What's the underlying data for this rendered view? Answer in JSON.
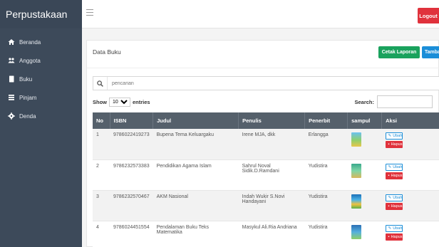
{
  "app": {
    "brand": "Perpustakaan"
  },
  "sidebar": {
    "items": [
      {
        "label": "Beranda",
        "icon": "home-icon"
      },
      {
        "label": "Anggota",
        "icon": "users-icon"
      },
      {
        "label": "Buku",
        "icon": "book-icon"
      },
      {
        "label": "Pinjam",
        "icon": "list-icon"
      },
      {
        "label": "Denda",
        "icon": "gear-icon"
      }
    ]
  },
  "header": {
    "logout_label": "Logout"
  },
  "page": {
    "title": "Data Buku",
    "cetak_label": "Cetak Laporan",
    "tambah_label": "Tambah",
    "search_placeholder": "pencarian",
    "show_label": "Show",
    "entries_value": "10",
    "entries_label": "entries",
    "search_label": "Search:"
  },
  "table": {
    "headers": [
      "No",
      "ISBN",
      "Judul",
      "Penulis",
      "Penerbit",
      "sampul",
      "Aksi"
    ],
    "edit_label": "Ubah",
    "delete_label": "Hapus",
    "rows": [
      {
        "no": "1",
        "isbn": "9786022419273",
        "judul": "Bupena Tema Keluargaku",
        "penulis": "Irene MJA, dkk",
        "penerbit": "Erlangga"
      },
      {
        "no": "2",
        "isbn": "9786232573383",
        "judul": "Pendidikan Agama Islam",
        "penulis": "Sahrul Noval Sidik.D.Ramdani",
        "penerbit": "Yudistira"
      },
      {
        "no": "3",
        "isbn": "9786232570467",
        "judul": "AKM Nasional",
        "penulis": "Indah Wukir S.Novi Handayani",
        "penerbit": "Yudistira"
      },
      {
        "no": "4",
        "isbn": "9786024451554",
        "judul": "Pendalaman Buku Teks Matematika",
        "penulis": "Masykul Ali.Ria Andriana",
        "penerbit": "Yudistira"
      }
    ]
  },
  "colors": {
    "sidebar": "#3d4a5a",
    "logout": "#e0323c",
    "cetak": "#1aa25d",
    "tambah": "#1b8ed8",
    "table_header": "#55606b"
  }
}
